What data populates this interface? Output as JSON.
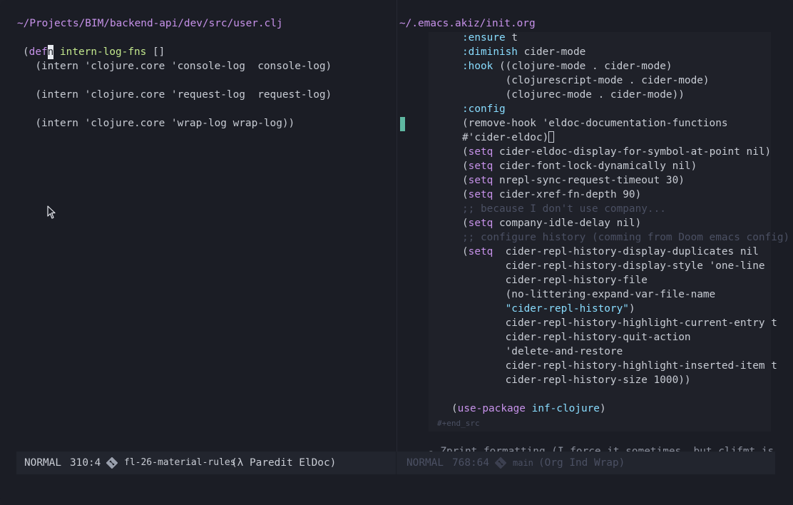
{
  "left_pane": {
    "path": "~/Projects/BIM/backend-api/dev/src/user.clj",
    "lines": [
      {
        "open": "(",
        "kw": "def",
        "cursor_char": "n",
        "name": "intern-log-fns",
        "rest": " []"
      },
      "  (intern 'clojure.core 'console-log  console-log)",
      "  (intern 'clojure.core 'request-log  request-log)",
      "  (intern 'clojure.core 'wrap-log wrap-log))"
    ],
    "modeline": {
      "mode": "NORMAL",
      "position": "310:4",
      "branch": "fl-26-material-rules",
      "minor_modes": "(λ Paredit ElDoc)"
    }
  },
  "right_pane": {
    "path": "~/.emacs.akiz/init.org",
    "code": [
      {
        "k": ":ensure",
        "v": " t"
      },
      {
        "k": ":diminish",
        "v": " cider-mode"
      },
      {
        "k": ":hook",
        "v": " ((clojure-mode . cider-mode)"
      },
      {
        "t": "       (clojurescript-mode . cider-mode)"
      },
      {
        "t": "       (clojurec-mode . cider-mode))"
      },
      {
        "k": ":config",
        "v": ""
      },
      {
        "t": "(remove-hook 'eldoc-documentation-functions"
      },
      {
        "t": "#'cider-eldoc)",
        "cursor": true
      },
      {
        "s": "setq",
        "v": " cider-eldoc-display-for-symbol-at-point nil)"
      },
      {
        "s": "setq",
        "v": " cider-font-lock-dynamically nil)"
      },
      {
        "s": "setq",
        "v": " nrepl-sync-request-timeout 30)"
      },
      {
        "s": "setq",
        "v": " cider-xref-fn-depth 90)"
      },
      {
        "c": ";; because I don't use company..."
      },
      {
        "s": "setq",
        "v": " company-idle-delay nil)"
      },
      {
        "c": ";; configure history (comming from Doom emacs config)"
      },
      {
        "s": "setq",
        "v": "  cider-repl-history-display-duplicates nil"
      },
      {
        "t": "       cider-repl-history-display-style 'one-line"
      },
      {
        "t": "       cider-repl-history-file"
      },
      {
        "t": "       (no-littering-expand-var-file-name"
      },
      {
        "str": "       \"cider-repl-history\"",
        "tail": ")"
      },
      {
        "t": "       cider-repl-history-highlight-current-entry t"
      },
      {
        "t": "       cider-repl-history-quit-action"
      },
      {
        "t": "       'delete-and-restore"
      },
      {
        "t": "       cider-repl-history-highlight-inserted-item t"
      },
      {
        "t": "       cider-repl-history-size 1000))"
      }
    ],
    "use_package": {
      "open": "(",
      "kw": "use-package",
      "name": "inf-clojure",
      "close": ")"
    },
    "end_src": "#+end_src",
    "org_line": "- Zprint formatting (I force it sometimes, but cljfmt is",
    "modeline": {
      "mode": "NORMAL",
      "position": "768:64",
      "branch": "main",
      "minor_modes": "(Org Ind Wrap)"
    }
  },
  "colors": {
    "background": "#1b1d25",
    "path": "#c792ea",
    "keyword": "#89ddff",
    "comment": "#4b5063",
    "cursor_gutter": "#5fb7a1"
  },
  "icons": [
    "git-branch-icon",
    "mouse-pointer-icon"
  ]
}
